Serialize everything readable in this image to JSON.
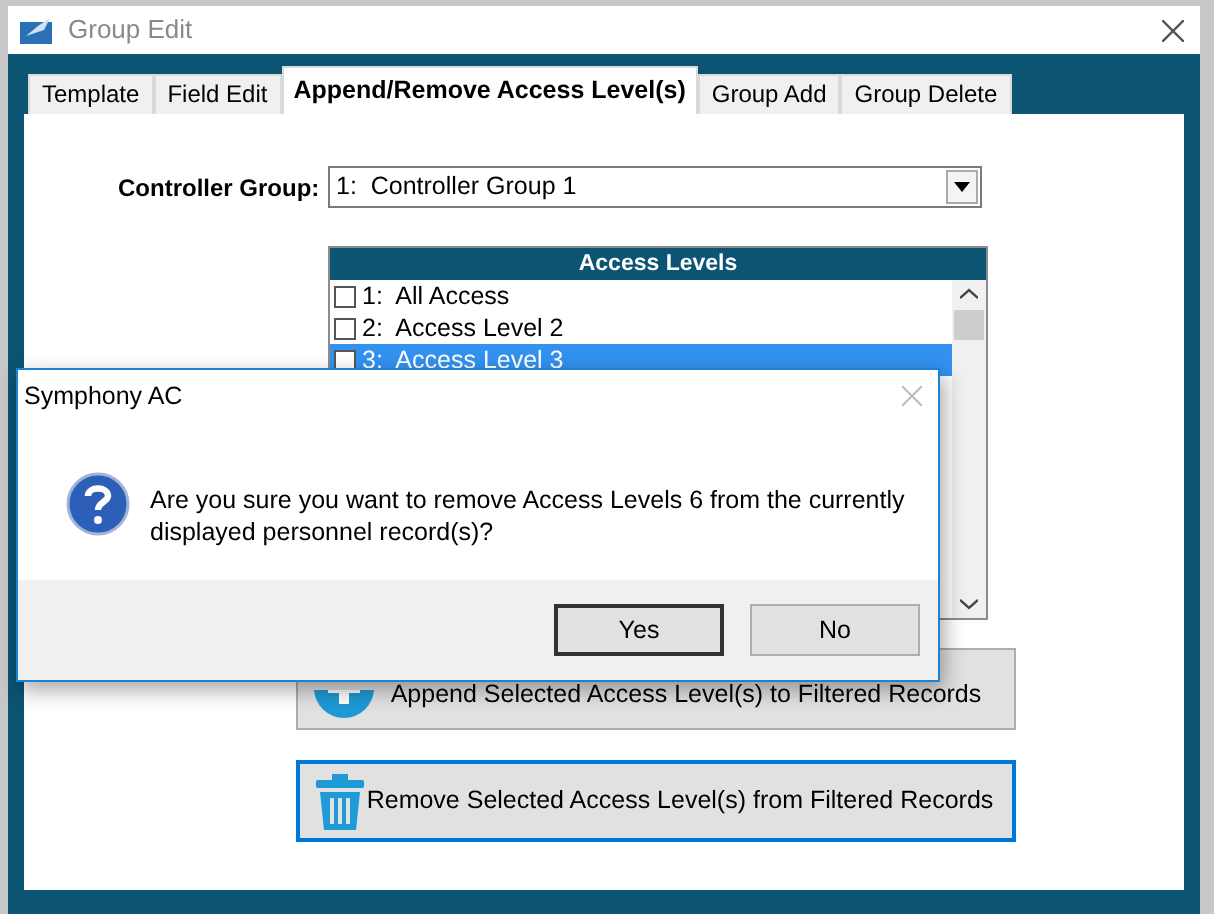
{
  "window": {
    "title": "Group Edit"
  },
  "tabs": [
    {
      "label": "Template",
      "selected": false
    },
    {
      "label": "Field Edit",
      "selected": false
    },
    {
      "label": "Append/Remove Access Level(s)",
      "selected": true
    },
    {
      "label": "Group Add",
      "selected": false
    },
    {
      "label": "Group Delete",
      "selected": false
    }
  ],
  "controller_group": {
    "label": "Controller Group:",
    "value": "1:  Controller Group 1"
  },
  "access_levels": {
    "header": "Access Levels",
    "items": [
      {
        "label": "1:  All Access",
        "checked": false,
        "selected": false
      },
      {
        "label": "2:  Access Level 2",
        "checked": false,
        "selected": false
      },
      {
        "label": "3:  Access Level 3",
        "checked": false,
        "selected": true
      }
    ]
  },
  "actions": [
    {
      "kind": "append",
      "label": "Append Selected Access Level(s) to Filtered Records",
      "focused": false
    },
    {
      "kind": "remove",
      "label": "Remove Selected Access Level(s) from Filtered Records",
      "focused": true
    }
  ],
  "dialog": {
    "title": "Symphony AC",
    "message": "Are you sure you want to remove Access Levels 6 from the currently displayed personnel record(s)?",
    "buttons": [
      {
        "label": "Yes",
        "default": true
      },
      {
        "label": "No",
        "default": false
      }
    ]
  }
}
